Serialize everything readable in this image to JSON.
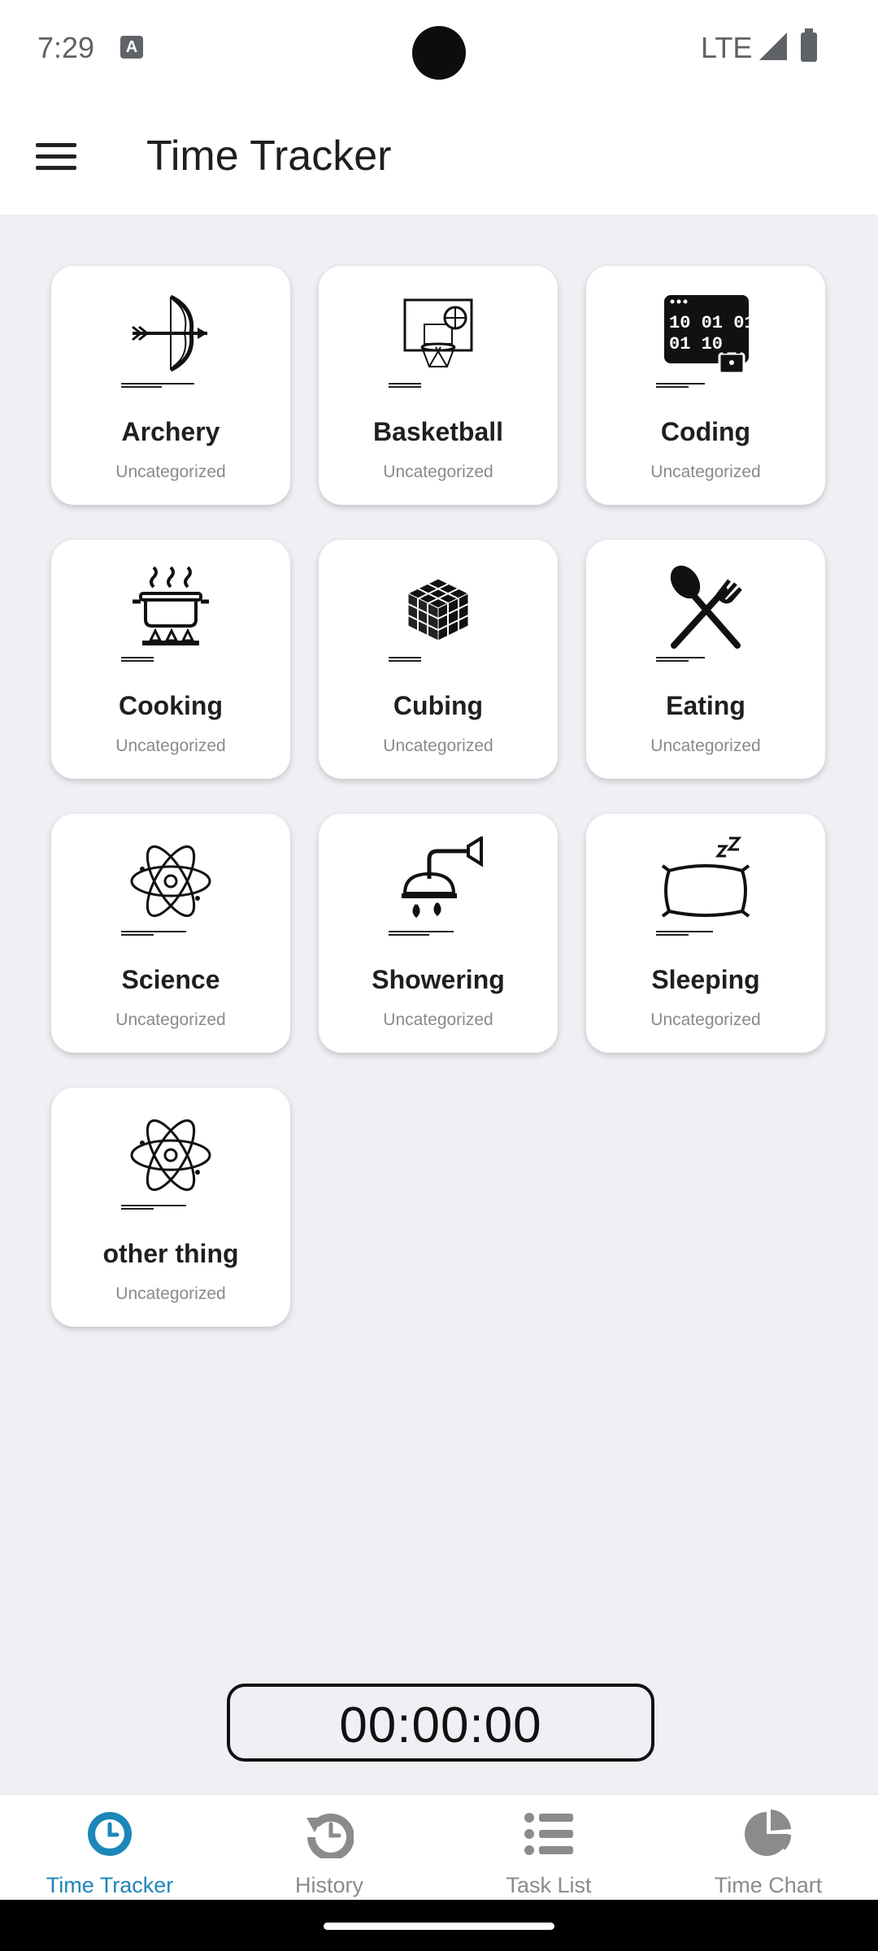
{
  "status_bar": {
    "time": "7:29",
    "keyboard_badge": "A",
    "network": "LTE"
  },
  "app_bar": {
    "title": "Time Tracker"
  },
  "activities": [
    {
      "name": "Archery",
      "category": "Uncategorized",
      "icon": "bow-arrow-icon"
    },
    {
      "name": "Basketball",
      "category": "Uncategorized",
      "icon": "basketball-hoop-icon"
    },
    {
      "name": "Coding",
      "category": "Uncategorized",
      "icon": "binary-lock-icon",
      "code_lines": [
        "10 01 01",
        "01 10"
      ]
    },
    {
      "name": "Cooking",
      "category": "Uncategorized",
      "icon": "cooking-pot-icon"
    },
    {
      "name": "Cubing",
      "category": "Uncategorized",
      "icon": "rubiks-cube-icon"
    },
    {
      "name": "Eating",
      "category": "Uncategorized",
      "icon": "spoon-fork-icon"
    },
    {
      "name": "Science",
      "category": "Uncategorized",
      "icon": "atom-icon"
    },
    {
      "name": "Showering",
      "category": "Uncategorized",
      "icon": "shower-head-icon"
    },
    {
      "name": "Sleeping",
      "category": "Uncategorized",
      "icon": "pillow-icon"
    },
    {
      "name": "other thing",
      "category": "Uncategorized",
      "icon": "atom-icon"
    }
  ],
  "timer": {
    "value": "00:00:00"
  },
  "bottom_nav": [
    {
      "label": "Time Tracker",
      "icon": "clock-icon",
      "active": true
    },
    {
      "label": "History",
      "icon": "history-icon",
      "active": false
    },
    {
      "label": "Task List",
      "icon": "list-icon",
      "active": false
    },
    {
      "label": "Time Chart",
      "icon": "pie-chart-icon",
      "active": false
    }
  ],
  "colors": {
    "accent": "#1b87b9",
    "inactive": "#8b8b8b",
    "background": "#efeff4"
  }
}
